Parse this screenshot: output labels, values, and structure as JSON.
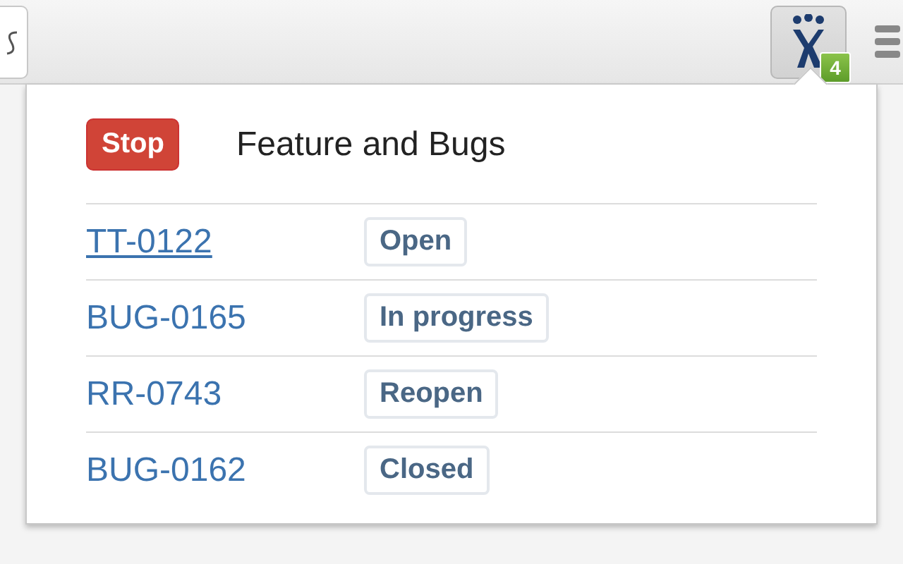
{
  "toolbar": {
    "extension_badge": "4"
  },
  "popup": {
    "stop_button": "Stop",
    "title": "Feature and Bugs",
    "issues": [
      {
        "key": "TT-0122",
        "status": "Open",
        "hovered": true
      },
      {
        "key": "BUG-0165",
        "status": "In progress",
        "hovered": false
      },
      {
        "key": "RR-0743",
        "status": "Reopen",
        "hovered": false
      },
      {
        "key": "BUG-0162",
        "status": "Closed",
        "hovered": false
      }
    ]
  }
}
